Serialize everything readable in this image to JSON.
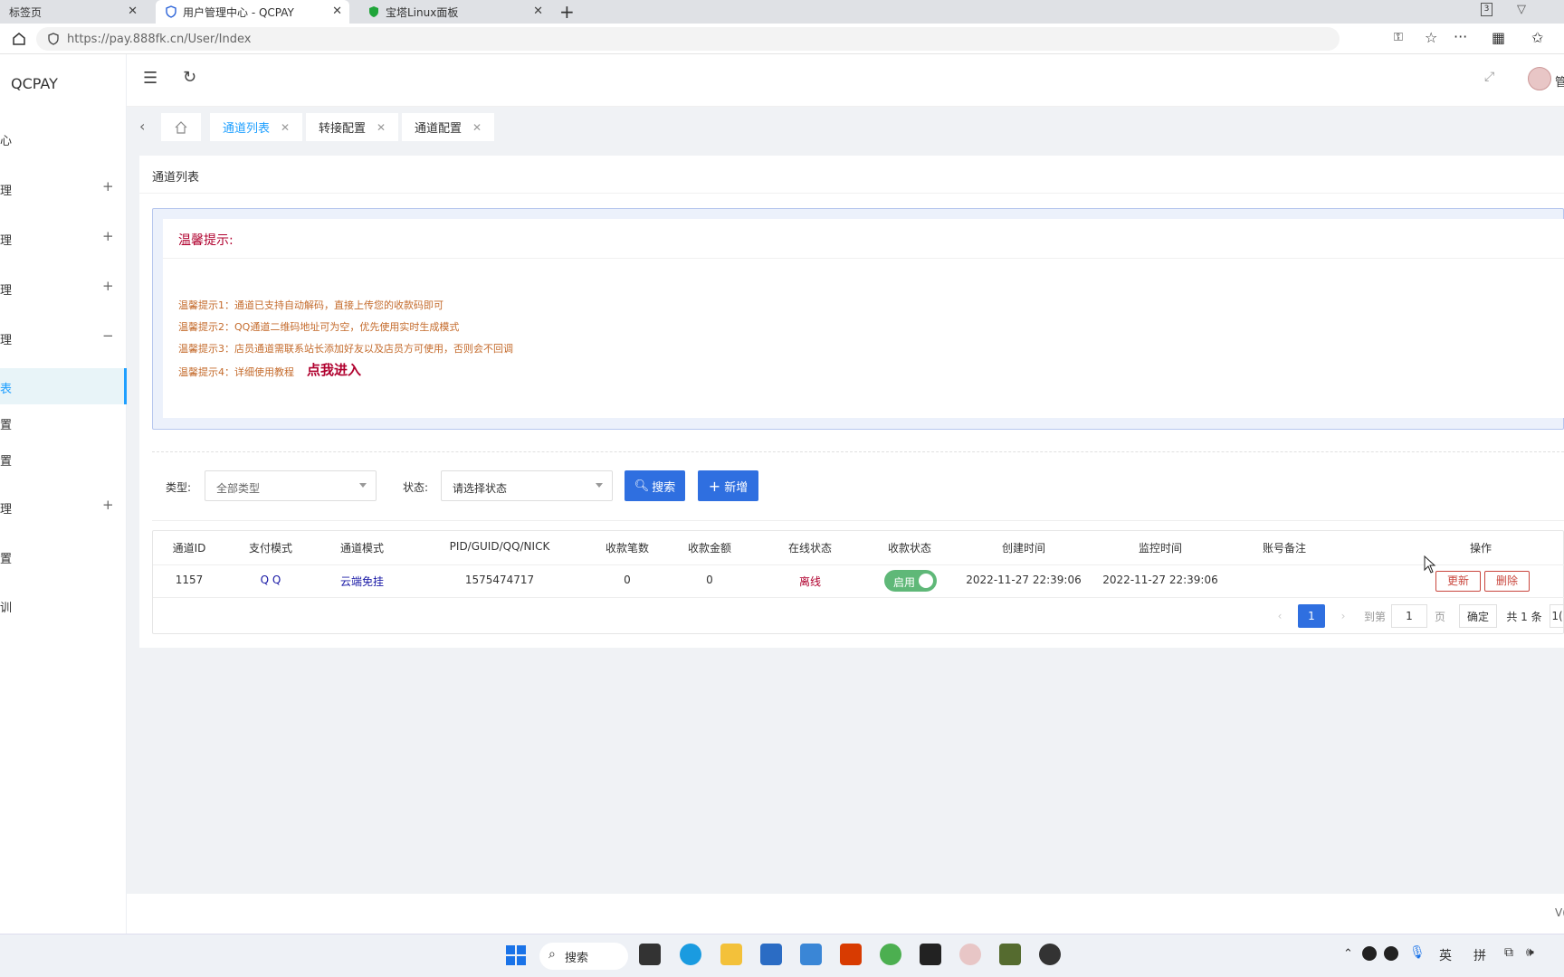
{
  "browser": {
    "tabs": [
      {
        "label": "标签页",
        "active": false
      },
      {
        "label": "用户管理中心 - QCPAY",
        "active": true
      },
      {
        "label": "宝塔Linux面板",
        "active": false
      }
    ],
    "new_tab": "+",
    "url": "https://pay.888fk.cn/User/Index",
    "tab_count": "3"
  },
  "sidebar": {
    "logo": "QCPAY",
    "items": [
      {
        "label": "心",
        "toggle": ""
      },
      {
        "label": "理",
        "toggle": "+"
      },
      {
        "label": "理",
        "toggle": "+"
      },
      {
        "label": "理",
        "toggle": "+"
      },
      {
        "label": "理",
        "toggle": "−"
      },
      {
        "label": "表",
        "toggle": ""
      },
      {
        "label": "置",
        "toggle": ""
      },
      {
        "label": "置",
        "toggle": ""
      },
      {
        "label": "理",
        "toggle": "+"
      },
      {
        "label": "置",
        "toggle": ""
      },
      {
        "label": "训",
        "toggle": ""
      }
    ]
  },
  "header": {
    "user": "管"
  },
  "page_tabs": [
    {
      "label": "通道列表",
      "active": true
    },
    {
      "label": "转接配置",
      "active": false
    },
    {
      "label": "通道配置",
      "active": false
    }
  ],
  "card": {
    "title": "通道列表",
    "tip_title": "温馨提示:",
    "tips": [
      "温馨提示1：通道已支持自动解码，直接上传您的收款码即可",
      "温馨提示2：QQ通道二维码地址可为空，优先使用实时生成模式",
      "温馨提示3：店员通道需联系站长添加好友以及店员方可使用，否则会不回调",
      "温馨提示4：详细使用教程"
    ],
    "tip_link": "点我进入"
  },
  "filters": {
    "type_label": "类型:",
    "type_value": "全部类型",
    "status_label": "状态:",
    "status_value": "请选择状态",
    "search_btn": "搜索",
    "add_btn": "新增"
  },
  "table": {
    "headers": [
      "通道ID",
      "支付模式",
      "通道模式",
      "PID/GUID/QQ/NICK",
      "收款笔数",
      "收款金额",
      "在线状态",
      "收款状态",
      "创建时间",
      "监控时间",
      "账号备注",
      "操作"
    ],
    "rows": [
      {
        "id": "1157",
        "pay_mode": "Q Q",
        "channel_mode": "云端免挂",
        "pid": "1575474717",
        "count": "0",
        "amount": "0",
        "online": "离线",
        "collect": "启用",
        "created": "2022-11-27 22:39:06",
        "monitor": "2022-11-27 22:39:06",
        "remark": "",
        "update_btn": "更新",
        "delete_btn": "删除"
      }
    ]
  },
  "pagination": {
    "current": "1",
    "goto_label": "到第",
    "goto_value": "1",
    "page_label": "页",
    "confirm": "确定",
    "total": "共 1 条",
    "size": "1("
  },
  "footer": {
    "text": "V("
  },
  "taskbar": {
    "search": "搜索",
    "ime1": "英",
    "ime2": "拼",
    "colors": {
      "accent": "#2f6fe0",
      "brand": "#1e9fff",
      "warn": "#c46b2c",
      "tip_title": "#b0002e",
      "toggle_on": "#5fb878"
    }
  }
}
